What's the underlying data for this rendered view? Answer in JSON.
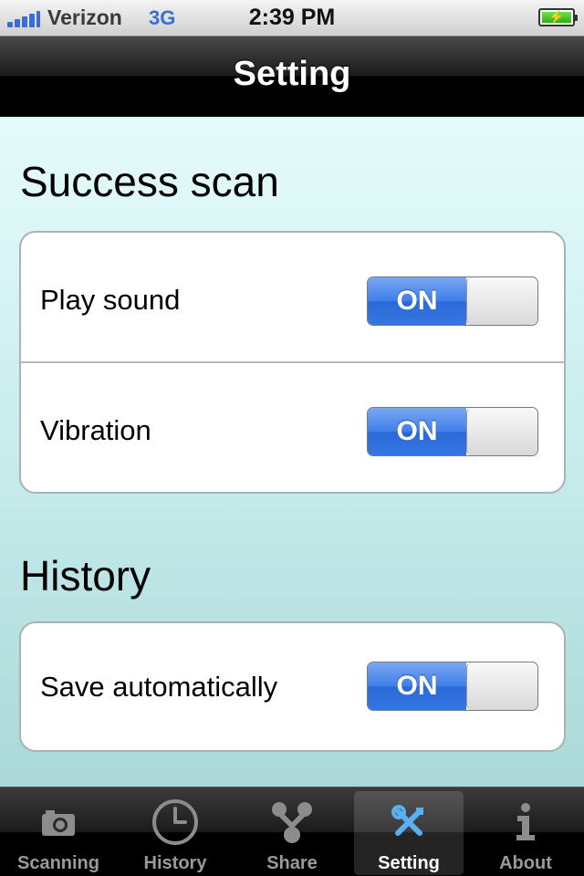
{
  "status_bar": {
    "carrier": "Verizon",
    "network": "3G",
    "time": "2:39 PM",
    "battery_icon": "battery-charging-icon"
  },
  "nav": {
    "title": "Setting"
  },
  "sections": [
    {
      "title": "Success scan",
      "rows": [
        {
          "label": "Play sound",
          "toggle": "ON"
        },
        {
          "label": "Vibration",
          "toggle": "ON"
        }
      ]
    },
    {
      "title": "History",
      "rows": [
        {
          "label": "Save automatically",
          "toggle": "ON"
        }
      ]
    }
  ],
  "tabs": [
    {
      "label": "Scanning",
      "icon": "camera-icon"
    },
    {
      "label": "History",
      "icon": "clock-icon"
    },
    {
      "label": "Share",
      "icon": "share-icon"
    },
    {
      "label": "Setting",
      "icon": "tools-icon",
      "selected": true
    },
    {
      "label": "About",
      "icon": "info-icon"
    }
  ],
  "colors": {
    "accent": "#3f7ee8",
    "selected_icon": "#5ab0f0",
    "unselected_icon": "#8c8c8c"
  }
}
